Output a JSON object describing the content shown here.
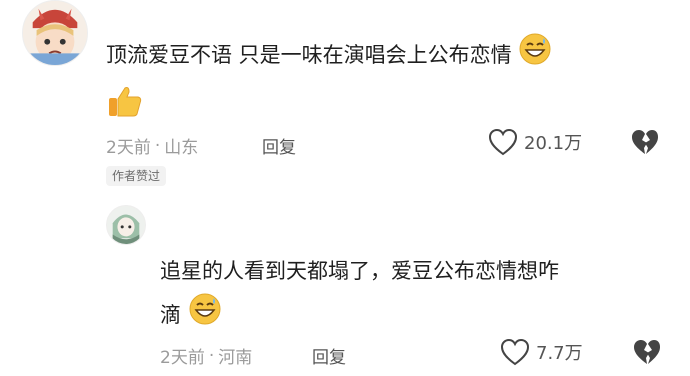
{
  "comments": [
    {
      "text": "顶流爱豆不语 只是一味在演唱会上公布恋情",
      "time": "2天前",
      "location": "山东",
      "reply_label": "回复",
      "likes": "20.1万",
      "badge": "作者赞过",
      "emojis": [
        "grinning-sweat-emoji",
        "thumbs-up-emoji"
      ]
    },
    {
      "text_line1": "追星的人看到天都塌了，爱豆公布恋情想咋",
      "text_line2": "滴",
      "time": "2天前",
      "location": "河南",
      "reply_label": "回复",
      "likes": "7.7万",
      "emojis": [
        "grinning-sweat-emoji"
      ]
    }
  ],
  "separator": "·",
  "icons": [
    "heart-outline-icon",
    "broken-heart-icon"
  ],
  "colors": {
    "meta": "#9b9b9b",
    "text": "#1f1f1f",
    "emoji_yellow": "#f7c542"
  }
}
